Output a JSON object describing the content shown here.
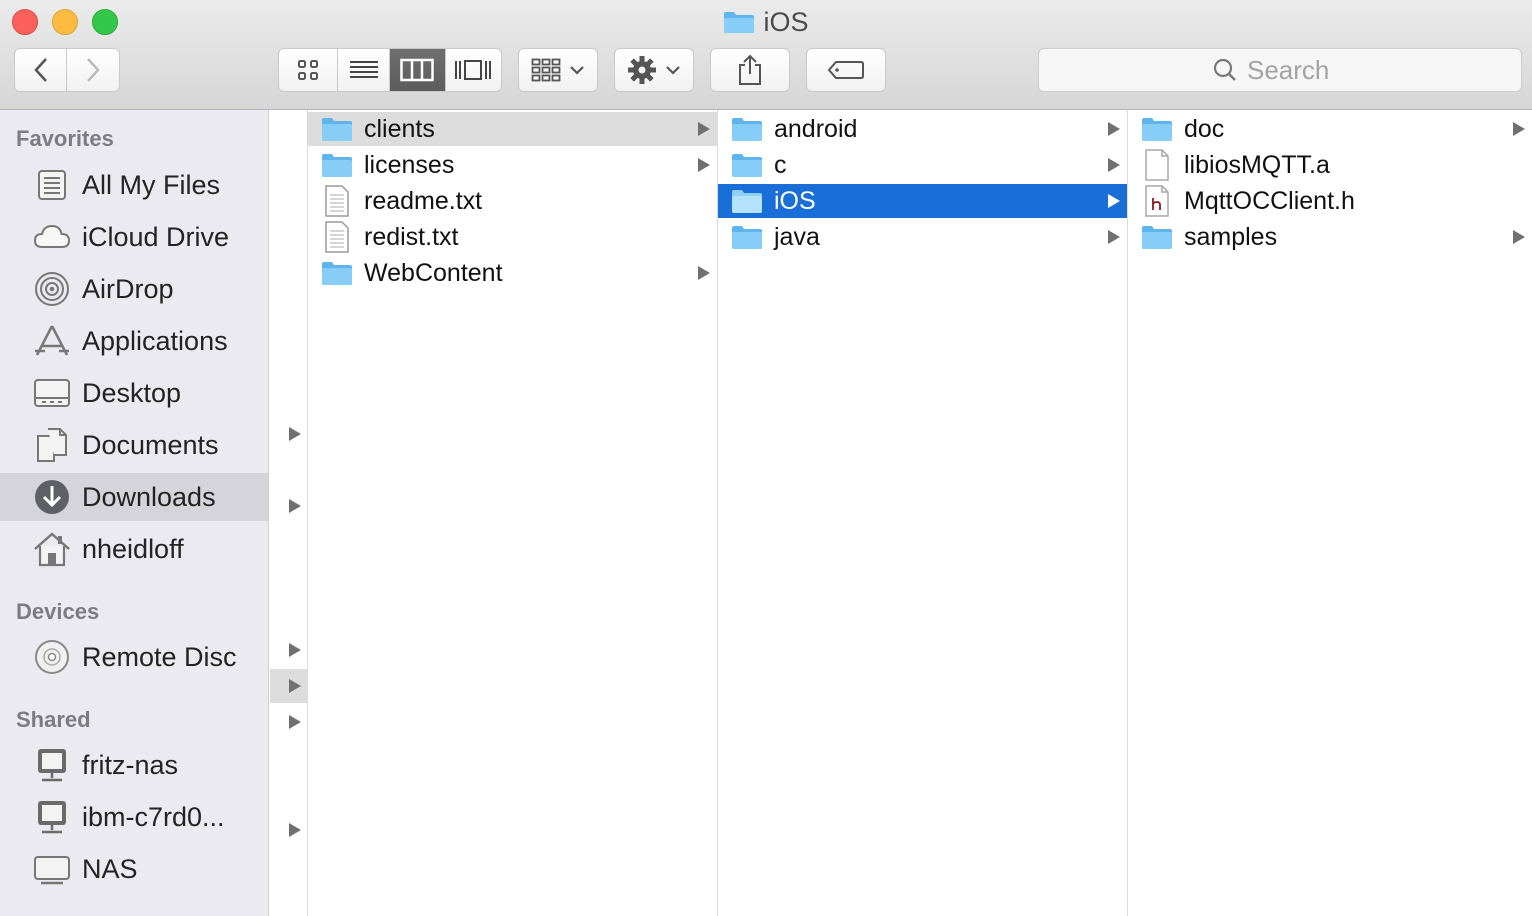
{
  "window": {
    "title": "iOS"
  },
  "toolbar": {
    "search_placeholder": "Search",
    "view_modes": [
      "icon",
      "list",
      "column",
      "cover-flow"
    ],
    "active_view": "column"
  },
  "sidebar": {
    "sections": [
      {
        "header": "Favorites",
        "items": [
          {
            "label": "All My Files",
            "icon": "all-my-files-icon"
          },
          {
            "label": "iCloud Drive",
            "icon": "icloud-icon"
          },
          {
            "label": "AirDrop",
            "icon": "airdrop-icon"
          },
          {
            "label": "Applications",
            "icon": "applications-icon"
          },
          {
            "label": "Desktop",
            "icon": "desktop-icon"
          },
          {
            "label": "Documents",
            "icon": "documents-icon"
          },
          {
            "label": "Downloads",
            "icon": "downloads-icon",
            "selected": true
          },
          {
            "label": "nheidloff",
            "icon": "home-icon"
          }
        ]
      },
      {
        "header": "Devices",
        "items": [
          {
            "label": "Remote Disc",
            "icon": "disc-icon"
          }
        ]
      },
      {
        "header": "Shared",
        "items": [
          {
            "label": "fritz-nas",
            "icon": "network-computer-icon"
          },
          {
            "label": "ibm-c7rd0...",
            "icon": "network-computer-icon"
          },
          {
            "label": "NAS",
            "icon": "network-drive-icon"
          }
        ]
      }
    ]
  },
  "columns": [
    {
      "items": [
        {
          "name": "clients",
          "kind": "folder",
          "state": "dim-selected",
          "has_children": true
        },
        {
          "name": "licenses",
          "kind": "folder",
          "has_children": true
        },
        {
          "name": "readme.txt",
          "kind": "text"
        },
        {
          "name": "redist.txt",
          "kind": "text"
        },
        {
          "name": "WebContent",
          "kind": "folder",
          "has_children": true
        }
      ]
    },
    {
      "items": [
        {
          "name": "android",
          "kind": "folder",
          "has_children": true
        },
        {
          "name": "c",
          "kind": "folder",
          "has_children": true
        },
        {
          "name": "iOS",
          "kind": "folder",
          "state": "selected",
          "has_children": true
        },
        {
          "name": "java",
          "kind": "folder",
          "has_children": true
        }
      ]
    },
    {
      "items": [
        {
          "name": "doc",
          "kind": "folder",
          "has_children": true
        },
        {
          "name": "libiosMQTT.a",
          "kind": "file"
        },
        {
          "name": "MqttOCClient.h",
          "kind": "header"
        },
        {
          "name": "samples",
          "kind": "folder",
          "has_children": true
        }
      ]
    }
  ],
  "colors": {
    "selection": "#1a6ed8",
    "folder": "#6cc0f2",
    "sidebar_bg": "#eaeaf0"
  }
}
